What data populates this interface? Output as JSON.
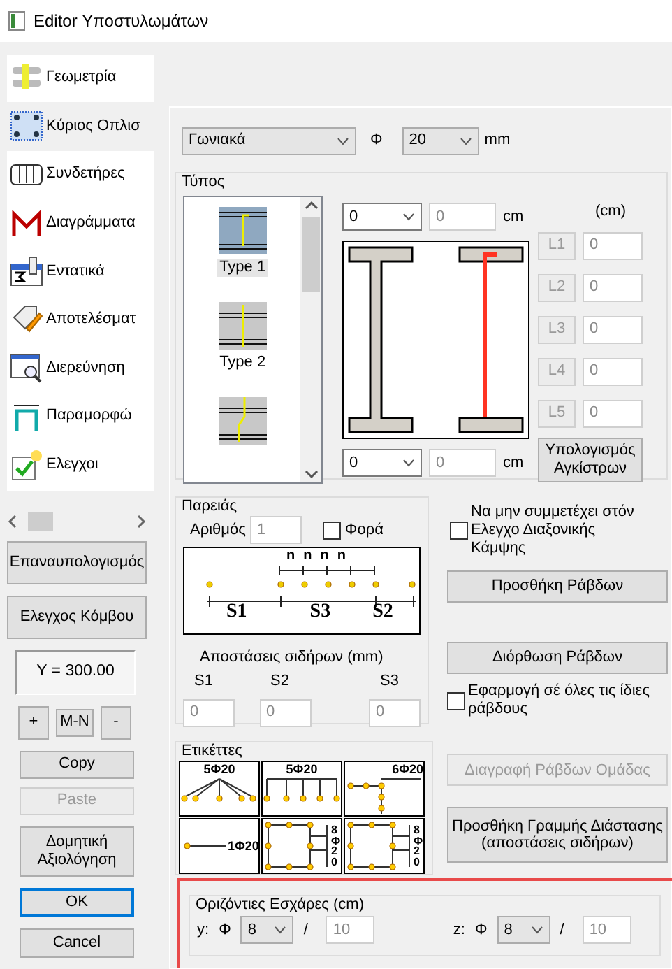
{
  "window": {
    "title": "Editor Υποστυλωμάτων"
  },
  "sidebar": {
    "items": [
      {
        "label": "Γεωμετρία",
        "selected": false
      },
      {
        "label": "Κύριος Οπλισ",
        "selected": true
      },
      {
        "label": "Συνδετήρες",
        "selected": false
      },
      {
        "label": "Διαγράμματα",
        "selected": false
      },
      {
        "label": "Εντατικά",
        "selected": false
      },
      {
        "label": "Αποτελέσματ",
        "selected": false
      },
      {
        "label": "Διερεύνηση",
        "selected": false
      },
      {
        "label": "Παραμορφώ",
        "selected": false
      },
      {
        "label": "Ελεγχοι",
        "selected": false
      }
    ]
  },
  "left_panel": {
    "actions": [
      "Επαναυπολογισμός",
      "Ελεγχος Κόμβου"
    ],
    "position_display": "Y = 300.00",
    "step_buttons": [
      "+",
      "M-N",
      "-"
    ],
    "clipboard": [
      {
        "label": "Copy",
        "disabled": false
      },
      {
        "label": "Paste",
        "disabled": true
      }
    ],
    "evaluate_button": "Δομητική Αξιολόγηση",
    "dialog_buttons": [
      {
        "label": "OK",
        "default": true
      },
      {
        "label": "Cancel",
        "default": false
      }
    ]
  },
  "bar_shape": {
    "value": "Γωνιακά",
    "diameter_label": "Φ",
    "diameter": "20",
    "unit": "mm"
  },
  "type_group": {
    "title": "Τύπος",
    "types": [
      {
        "kind": "hooked",
        "label": "Type 1",
        "selected": true
      },
      {
        "kind": "straight",
        "label": "Type 2",
        "selected": false
      },
      {
        "kind": "cranked",
        "selected": false
      }
    ],
    "top_end": {
      "value": "0",
      "length": "0",
      "unit": "cm"
    },
    "bottom_end": {
      "value": "0",
      "length": "0",
      "unit": "cm"
    },
    "legs_unit": "(cm)",
    "legs": [
      {
        "label": "L1",
        "value": "0"
      },
      {
        "label": "L2",
        "value": "0"
      },
      {
        "label": "L3",
        "value": "0"
      },
      {
        "label": "L4",
        "value": "0"
      },
      {
        "label": "L5",
        "value": "0"
      }
    ],
    "hook_button": "Υπολογισμός Αγκίστρων"
  },
  "faces": {
    "title": "Παρειάς",
    "count_label": "Αριθμός",
    "count": "1",
    "direction": {
      "label": "Φορά",
      "checked": false
    },
    "diagram_spacing_labels": [
      "n",
      "n",
      "n",
      "n"
    ],
    "diagram_segment_labels": [
      "S1",
      "S3",
      "S2"
    ],
    "spacings_title": "Αποστάσεις σιδήρων (mm)",
    "spacings": [
      {
        "label": "S1",
        "value": "0"
      },
      {
        "label": "S2",
        "value": "0"
      },
      {
        "label": "S3",
        "value": "0"
      }
    ]
  },
  "exclude_check": {
    "label": "Να μην συμμετέχει στόν Ελεγχο Διαξονικής Κάμψης",
    "checked": false
  },
  "add_bars_button": "Προσθήκη Ράβδων",
  "edit_bars_button": "Διόρθωση Ράβδων",
  "apply_all": {
    "label": "Εφαρμογή σέ όλες τις ίδιες ράβδους",
    "checked": false
  },
  "labels_group": {
    "title": "Ετικέττες",
    "tiles": [
      {
        "kind": "fan",
        "text": "5Φ20"
      },
      {
        "kind": "comb",
        "text": "5Φ20"
      },
      {
        "kind": "tee",
        "text": "6Φ20"
      },
      {
        "kind": "line",
        "text": "1Φ20"
      },
      {
        "kind": "frame",
        "text": "8Φ20"
      },
      {
        "kind": "frame",
        "text": "8Φ20"
      }
    ]
  },
  "delete_group_button": {
    "label": "Διαγραφή Ράβδων Ομάδας",
    "disabled": true
  },
  "dimension_button": "Προσθήκη Γραμμής Διάστασης (αποστάσεις σιδήρων)",
  "horizontal_grids": {
    "title": "Οριζόντιες Εσχάρες (cm)",
    "axes": [
      {
        "axis": "y:",
        "diameter_label": "Φ",
        "diameter": "8",
        "separator": "/",
        "spacing": "10"
      },
      {
        "axis": "z:",
        "diameter_label": "Φ",
        "diameter": "8",
        "separator": "/",
        "spacing": "10"
      }
    ]
  }
}
